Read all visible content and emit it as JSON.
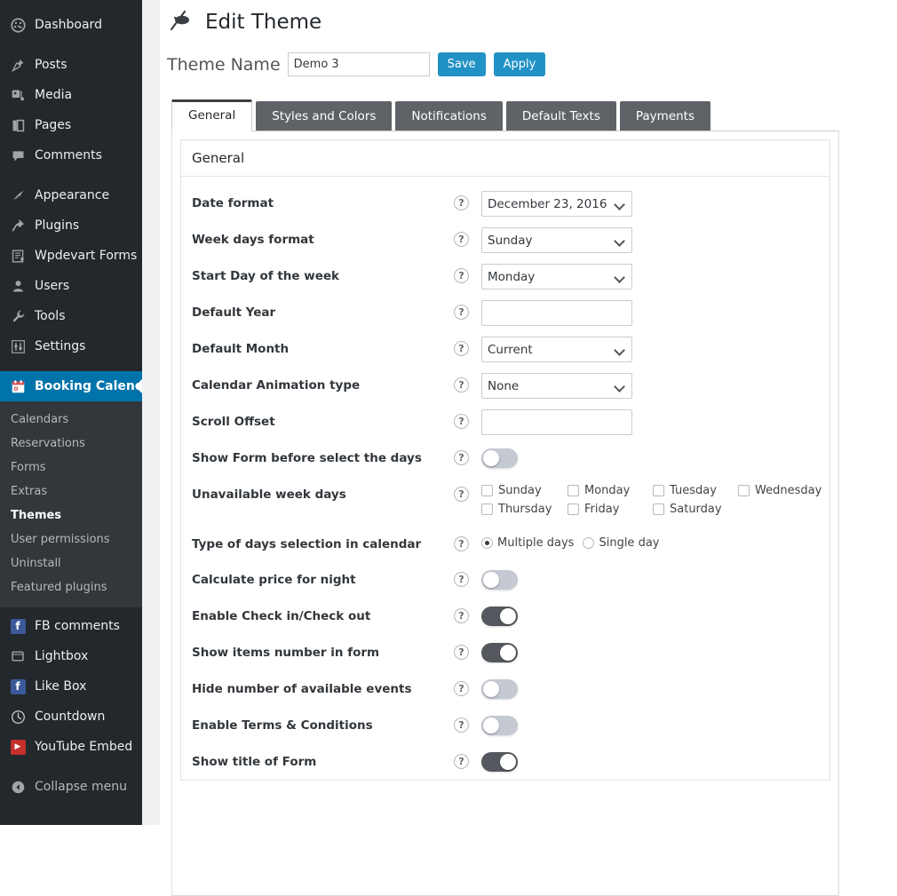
{
  "sidebar": {
    "main_items": [
      {
        "label": "Dashboard",
        "icon": "dashboard-icon"
      },
      {
        "label": "Posts",
        "icon": "pin-icon"
      },
      {
        "label": "Media",
        "icon": "media-icon"
      },
      {
        "label": "Pages",
        "icon": "pages-icon"
      },
      {
        "label": "Comments",
        "icon": "comments-icon"
      },
      {
        "label": "Appearance",
        "icon": "appearance-brush-icon"
      },
      {
        "label": "Plugins",
        "icon": "plugin-icon"
      },
      {
        "label": "Wpdevart Forms",
        "icon": "forms-icon"
      },
      {
        "label": "Users",
        "icon": "users-icon"
      },
      {
        "label": "Tools",
        "icon": "tools-wrench-icon"
      },
      {
        "label": "Settings",
        "icon": "settings-sliders-icon"
      }
    ],
    "current_item": {
      "label": "Booking Calendar",
      "icon": "calendar-icon"
    },
    "submenu": [
      {
        "label": "Calendars",
        "active": false
      },
      {
        "label": "Reservations",
        "active": false
      },
      {
        "label": "Forms",
        "active": false
      },
      {
        "label": "Extras",
        "active": false
      },
      {
        "label": "Themes",
        "active": true
      },
      {
        "label": "User permissions",
        "active": false
      },
      {
        "label": "Uninstall",
        "active": false
      },
      {
        "label": "Featured plugins",
        "active": false
      }
    ],
    "plugin_items": [
      {
        "label": "FB comments",
        "icon": "facebook-icon"
      },
      {
        "label": "Lightbox",
        "icon": "lightbox-icon"
      },
      {
        "label": "Like Box",
        "icon": "facebook-icon"
      },
      {
        "label": "Countdown",
        "icon": "clock-icon"
      },
      {
        "label": "YouTube Embed",
        "icon": "youtube-icon"
      }
    ],
    "collapse": {
      "label": "Collapse menu",
      "icon": "collapse-arrow-icon"
    }
  },
  "header": {
    "title": "Edit Theme",
    "icon": "edit-theme-icon"
  },
  "theme_bar": {
    "label": "Theme Name",
    "value": "Demo 3",
    "placeholder": "",
    "save_label": "Save",
    "apply_label": "Apply"
  },
  "tabs": [
    {
      "label": "General",
      "active": true
    },
    {
      "label": "Styles and Colors",
      "active": false
    },
    {
      "label": "Notifications",
      "active": false
    },
    {
      "label": "Default Texts",
      "active": false
    },
    {
      "label": "Payments",
      "active": false
    }
  ],
  "panel": {
    "title": "General",
    "rows": [
      {
        "label": "Date format",
        "control": "select",
        "value": "December 23, 2016",
        "help": "?"
      },
      {
        "label": "Week days format",
        "control": "select",
        "value": "Sunday",
        "help": "?"
      },
      {
        "label": "Start Day of the week",
        "control": "select",
        "value": "Monday",
        "help": "?"
      },
      {
        "label": "Default Year",
        "control": "text",
        "value": "",
        "help": "?"
      },
      {
        "label": "Default Month",
        "control": "select",
        "value": "Current",
        "help": "?"
      },
      {
        "label": "Calendar Animation type",
        "control": "select",
        "value": "None",
        "help": "?"
      },
      {
        "label": "Scroll Offset",
        "control": "text",
        "value": "",
        "help": "?"
      },
      {
        "label": "Show Form before select the days",
        "control": "toggle",
        "value": "off",
        "help": "?"
      },
      {
        "label": "Unavailable week days",
        "control": "checkboxes",
        "value": "",
        "help": "?"
      },
      {
        "label": "Type of days selection in calendar",
        "control": "radios",
        "value": "Multiple days",
        "help": "?"
      },
      {
        "label": "Calculate price for night",
        "control": "toggle",
        "value": "off",
        "help": "?"
      },
      {
        "label": "Enable Check in/Check out",
        "control": "toggle",
        "value": "on",
        "help": "?"
      },
      {
        "label": "Show items number in form",
        "control": "toggle",
        "value": "on",
        "help": "?"
      },
      {
        "label": "Hide number of available events",
        "control": "toggle",
        "value": "off",
        "help": "?"
      },
      {
        "label": "Enable Terms & Conditions",
        "control": "toggle",
        "value": "off",
        "help": "?"
      },
      {
        "label": "Show title of Form",
        "control": "toggle",
        "value": "on",
        "help": "?"
      }
    ],
    "weekdays": [
      "Sunday",
      "Monday",
      "Tuesday",
      "Wednesday",
      "Thursday",
      "Friday",
      "Saturday"
    ],
    "selection_types": [
      "Multiple days",
      "Single day"
    ]
  },
  "colors": {
    "sidebar_bg": "#23282d",
    "submenu_bg": "#32373c",
    "accent_blue": "#0073aa",
    "button_blue": "#2192c6",
    "tab_gray": "#5f6368",
    "toggle_on": "#55585e",
    "toggle_off": "#c4c9d2"
  }
}
